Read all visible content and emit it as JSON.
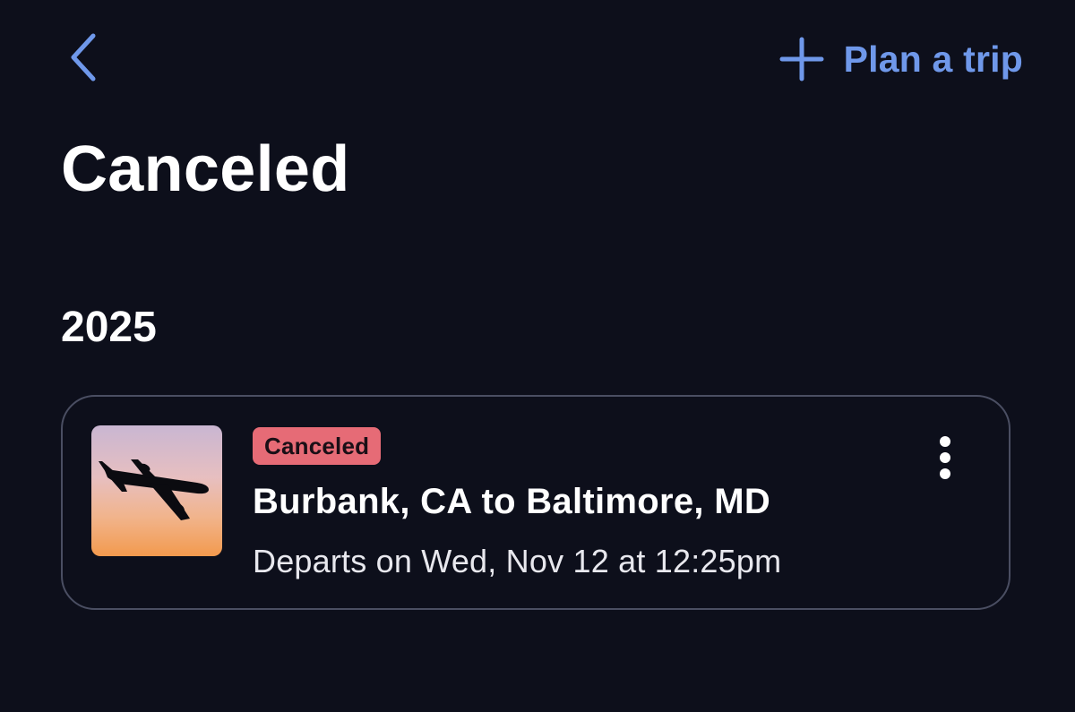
{
  "header": {
    "back_icon": "chevron-left-icon",
    "plan_trip_icon": "plus-icon",
    "plan_trip_label": "Plan a trip",
    "accent_color": "#6f98ea"
  },
  "page": {
    "title": "Canceled"
  },
  "sections": [
    {
      "year": "2025",
      "trips": [
        {
          "status": "Canceled",
          "status_color": "#e66b76",
          "route": "Burbank, CA to Baltimore, MD",
          "departs": "Departs on Wed, Nov 12 at 12:25pm",
          "thumbnail_icon": "airplane-icon",
          "menu_icon": "more-vertical-icon"
        }
      ]
    }
  ]
}
